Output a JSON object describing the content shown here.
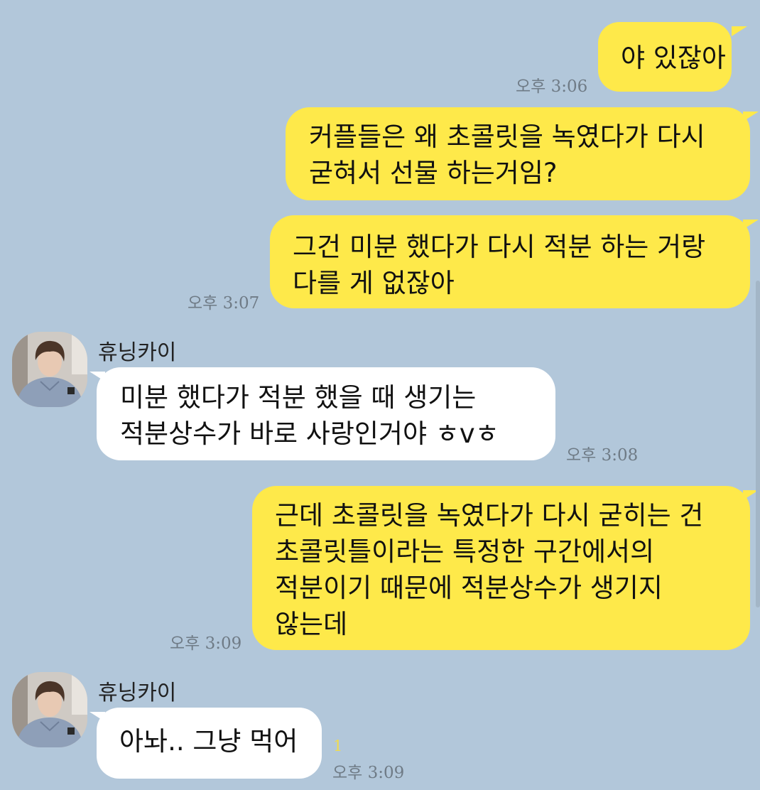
{
  "messages": [
    {
      "from": "me",
      "text": "야 있잖아",
      "time": "오후 3:06"
    },
    {
      "from": "me",
      "text": "커플들은 왜 초콜릿을 녹였다가 다시\n굳혀서 선물 하는거임?"
    },
    {
      "from": "me",
      "text": "그건 미분 했다가 다시 적분 하는 거랑\n다를 게 없잖아",
      "time": "오후 3:07"
    },
    {
      "from": "them",
      "sender": "휴닝카이",
      "text": "미분 했다가 적분 했을 때 생기는\n적분상수가 바로 사랑인거야 ㅎvㅎ",
      "time": "오후 3:08"
    },
    {
      "from": "me",
      "text": "근데 초콜릿을 녹였다가 다시 굳히는 건\n초콜릿틀이라는 특정한 구간에서의\n적분이기 때문에 적분상수가 생기지\n않는데",
      "time": "오후 3:09"
    },
    {
      "from": "them",
      "sender": "휴닝카이",
      "text": "아놔.. 그냥 먹어",
      "time": "오후 3:09",
      "unread": "1"
    }
  ],
  "colors": {
    "background": "#b2c7da",
    "my_bubble": "#fee94a",
    "their_bubble": "#ffffff",
    "unread_count": "#f1dc4c"
  }
}
